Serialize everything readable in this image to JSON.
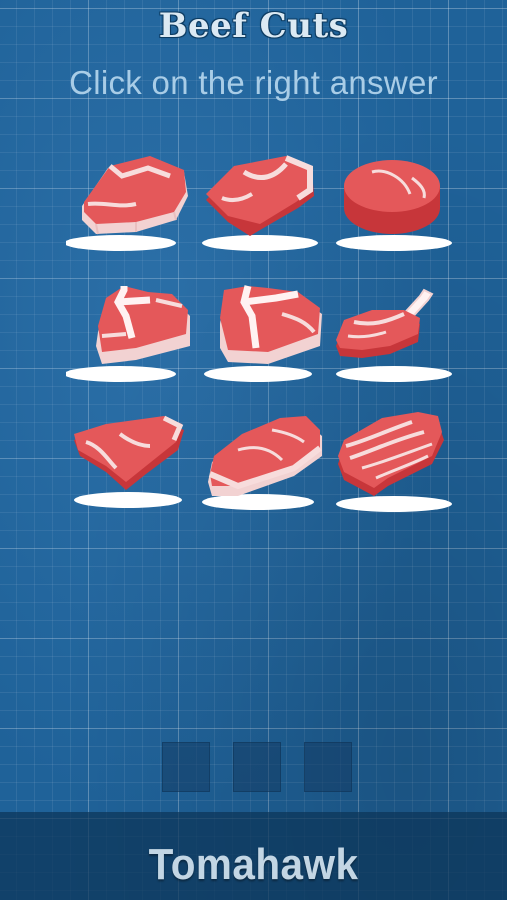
{
  "header": {
    "title": "Beef Cuts",
    "instruction": "Click on the right answer"
  },
  "options": [
    {
      "icon": "rib-steak-icon"
    },
    {
      "icon": "chuck-roast-icon"
    },
    {
      "icon": "round-steak-icon"
    },
    {
      "icon": "t-bone-steak-icon"
    },
    {
      "icon": "porterhouse-steak-icon"
    },
    {
      "icon": "tomahawk-steak-icon"
    },
    {
      "icon": "tri-tip-steak-icon"
    },
    {
      "icon": "sirloin-steak-icon"
    },
    {
      "icon": "brisket-icon"
    }
  ],
  "answer_slots": 3,
  "prompt": {
    "word": "Tomahawk"
  },
  "colors": {
    "background": "#1f6299",
    "meat": "#e4585a",
    "fat": "#f7dcdc",
    "plate": "#ffffff"
  }
}
